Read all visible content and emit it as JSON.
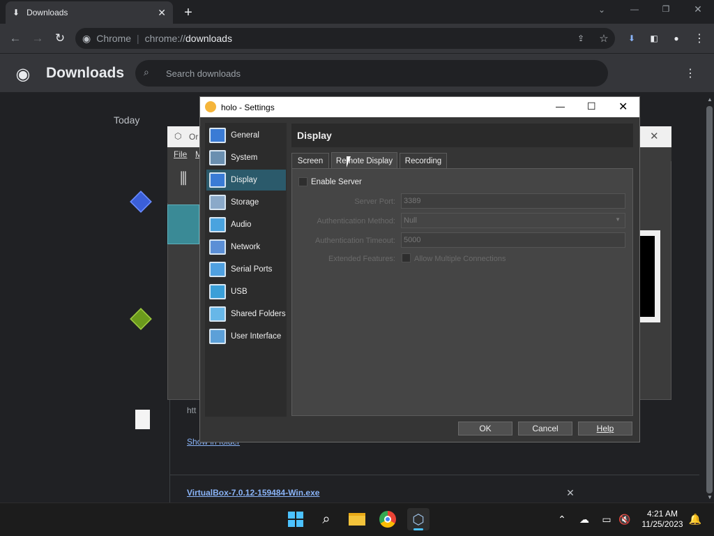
{
  "browser": {
    "tab_title": "Downloads",
    "omnibox": {
      "site": "Chrome",
      "scheme": "chrome://",
      "path": "downloads"
    }
  },
  "downloads_page": {
    "title": "Downloads",
    "search_placeholder": "Search downloads",
    "date_group": "Today",
    "partial_url": "htt",
    "show_in_folder": "Show in folder",
    "file_name": "VirtualBox-7.0.12-159484-Win.exe"
  },
  "vbox_manager": {
    "title_partial": "Or",
    "menu_file": "File",
    "menu_m": "M"
  },
  "settings": {
    "title": "holo - Settings",
    "nav": [
      {
        "label": "General",
        "icon": "general-icon"
      },
      {
        "label": "System",
        "icon": "system-icon"
      },
      {
        "label": "Display",
        "icon": "display-icon",
        "selected": true
      },
      {
        "label": "Storage",
        "icon": "storage-icon"
      },
      {
        "label": "Audio",
        "icon": "audio-icon"
      },
      {
        "label": "Network",
        "icon": "network-icon"
      },
      {
        "label": "Serial Ports",
        "icon": "serial-ports-icon"
      },
      {
        "label": "USB",
        "icon": "usb-icon"
      },
      {
        "label": "Shared Folders",
        "icon": "shared-folders-icon"
      },
      {
        "label": "User Interface",
        "icon": "user-interface-icon"
      }
    ],
    "section_title": "Display",
    "tabs": [
      "Screen",
      "Remote Display",
      "Recording"
    ],
    "active_tab": "Remote Display",
    "enable_server_label": "Enable Server",
    "enable_server_checked": false,
    "server_port_label": "Server Port:",
    "server_port_value": "3389",
    "auth_method_label": "Authentication Method:",
    "auth_method_value": "Null",
    "auth_timeout_label": "Authentication Timeout:",
    "auth_timeout_value": "5000",
    "extended_features_label": "Extended Features:",
    "allow_multiple_label": "Allow Multiple Connections",
    "buttons": {
      "ok": "OK",
      "cancel": "Cancel",
      "help": "Help"
    }
  },
  "taskbar": {
    "time": "4:21 AM",
    "date": "11/25/2023"
  },
  "colors": {
    "accent": "#2b5a6b",
    "link": "#8ab4f8"
  }
}
